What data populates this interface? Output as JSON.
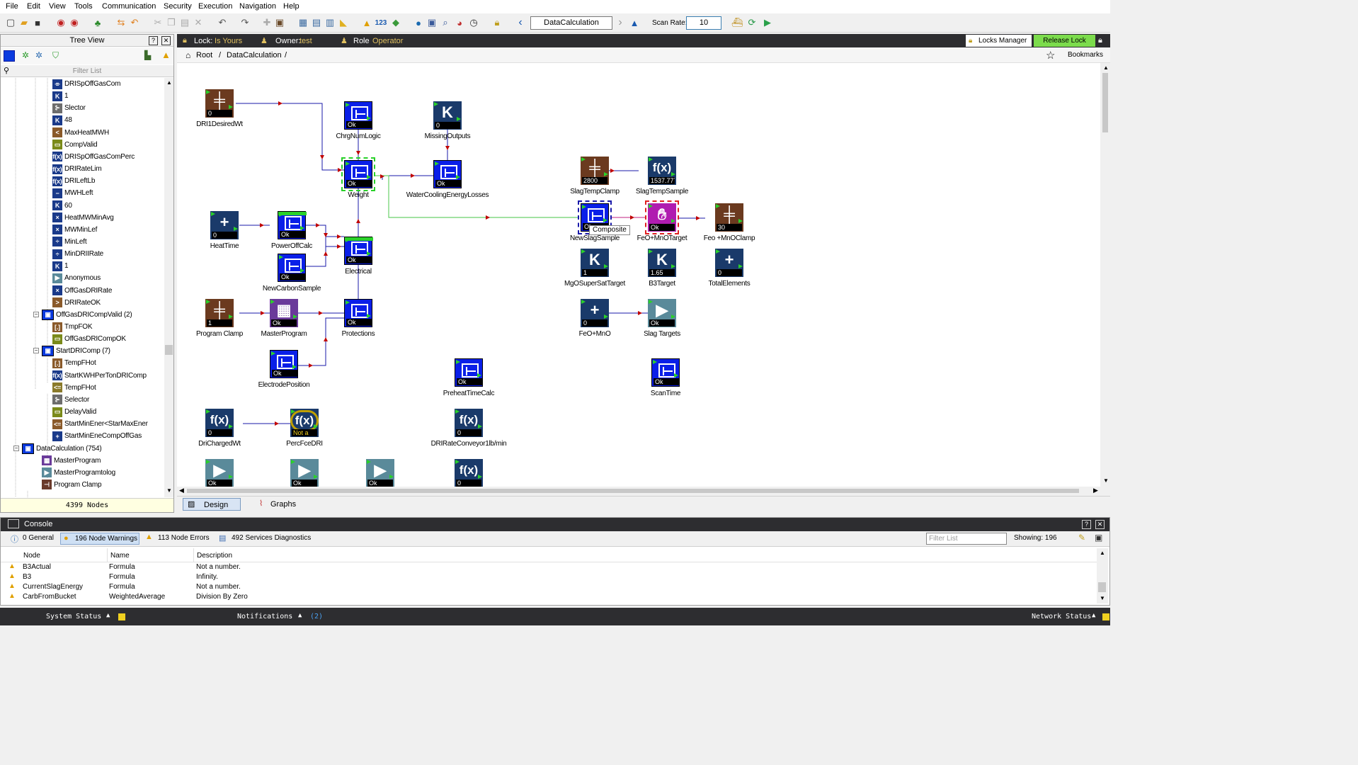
{
  "menu": [
    "File",
    "Edit",
    "View",
    "Tools",
    "Communication",
    "Security",
    "Execution",
    "Navigation",
    "Help"
  ],
  "toolbar": {
    "node_name": "DataCalculation",
    "scan_rate_label": "Scan Rate:",
    "scan_rate_value": "10",
    "badge_123": "123"
  },
  "tree": {
    "title": "Tree View",
    "filter_placeholder": "Filter List",
    "footer": "4399 Nodes",
    "items": [
      {
        "label": "DRISpOffGasCom",
        "icon": "switch-icon",
        "color": "#1a3a8a",
        "indent": 1
      },
      {
        "label": "1",
        "icon": "K",
        "color": "#1a3a8a",
        "indent": 1
      },
      {
        "label": "Slector",
        "icon": "selector-icon",
        "color": "#6d6d6d",
        "indent": 1
      },
      {
        "label": "48",
        "icon": "K",
        "color": "#1a3a8a",
        "indent": 1
      },
      {
        "label": "MaxHeatMWH",
        "icon": "<",
        "color": "#8a5a2a",
        "indent": 1
      },
      {
        "label": "CompValid",
        "icon": "delay-icon",
        "color": "#7a8a1a",
        "indent": 1
      },
      {
        "label": "DRISpOffGasComPerc",
        "icon": "f(x)",
        "color": "#1a3a8a",
        "indent": 1
      },
      {
        "label": "DRIRateLim",
        "icon": "f(x)",
        "color": "#1a3a8a",
        "indent": 1
      },
      {
        "label": "DRILeftLb",
        "icon": "f(x)",
        "color": "#1a3a8a",
        "indent": 1
      },
      {
        "label": "MWHLeft",
        "icon": "−",
        "color": "#1a3a8a",
        "indent": 1
      },
      {
        "label": "60",
        "icon": "K",
        "color": "#1a3a8a",
        "indent": 1
      },
      {
        "label": "HeatMWMinAvg",
        "icon": "×",
        "color": "#1a3a8a",
        "indent": 1
      },
      {
        "label": "MWMinLef",
        "icon": "×",
        "color": "#1a3a8a",
        "indent": 1
      },
      {
        "label": "MinLeft",
        "icon": "÷",
        "color": "#1a3a8a",
        "indent": 1
      },
      {
        "label": "MinDRIIRate",
        "icon": "÷",
        "color": "#1a3a8a",
        "indent": 1
      },
      {
        "label": "1",
        "icon": "K",
        "color": "#1a3a8a",
        "indent": 1
      },
      {
        "label": "Anonymous",
        "icon": "▶",
        "color": "#5a8a9a",
        "indent": 1
      },
      {
        "label": "OffGasDRIRate",
        "icon": "×",
        "color": "#1a3a8a",
        "indent": 1
      },
      {
        "label": "DRIRateOK",
        "icon": ">",
        "color": "#8a5a2a",
        "indent": 1
      },
      {
        "label": "OffGasDRICompValid  (2)",
        "icon": "composite-icon",
        "color": "#0a3adf",
        "indent": 0,
        "expand": true
      },
      {
        "label": "TmpFOK",
        "icon": "[.]",
        "color": "#8a5a2a",
        "indent": 1
      },
      {
        "label": "OffGasDRICompOK",
        "icon": "delay-icon",
        "color": "#7a8a1a",
        "indent": 1
      },
      {
        "label": "StartDRIComp  (7)",
        "icon": "composite-icon",
        "color": "#0a3adf",
        "indent": 0,
        "expand": true
      },
      {
        "label": "TempFHot",
        "icon": "[.]",
        "color": "#8a5a2a",
        "indent": 1
      },
      {
        "label": "StartKWHPerTonDRIComp",
        "icon": "f(x)",
        "color": "#1a3a8a",
        "indent": 1
      },
      {
        "label": "TempFHot",
        "icon": "<=",
        "color": "#8a7a2a",
        "indent": 1
      },
      {
        "label": "Selector",
        "icon": "selector-icon",
        "color": "#6d6d6d",
        "indent": 1
      },
      {
        "label": "DelayValid",
        "icon": "delay-icon",
        "color": "#7a8a1a",
        "indent": 1
      },
      {
        "label": "StartMinEner<StarMaxEner",
        "icon": "<=",
        "color": "#8a5a2a",
        "indent": 1
      },
      {
        "label": "StartMinEneCompOffGas",
        "icon": "+",
        "color": "#1a3a8a",
        "indent": 1
      },
      {
        "label": "DataCalculation  (754)",
        "icon": "composite-icon",
        "color": "#0a3adf",
        "indent": -1,
        "expand": true
      },
      {
        "label": "MasterProgram",
        "icon": "grid-icon",
        "color": "#6a3a9a",
        "indent": 0
      },
      {
        "label": "MasterProgramtolog",
        "icon": "▶",
        "color": "#5a8a9a",
        "indent": 0
      },
      {
        "label": "Program Clamp",
        "icon": "clamp-icon",
        "color": "#6a3a2a",
        "indent": 0
      }
    ]
  },
  "lockbar": {
    "lock_label": "Lock:",
    "lock_value": "Is Yours",
    "owner_label": "Owner:",
    "owner_value": "test",
    "role_label": "Role",
    "role_value": "Operator",
    "locks_manager": "Locks Manager",
    "release_lock": "Release Lock"
  },
  "breadcrumb": {
    "root": "Root",
    "current": "DataCalculation",
    "separator": "/",
    "bookmarks": "Bookmarks"
  },
  "tooltip": "Composite",
  "nodes": [
    {
      "id": "DRI1DesiredWt",
      "label": "DRI1DesiredWt",
      "type": "clamp",
      "value": "0"
    },
    {
      "id": "ChrgNumLogic",
      "label": "ChrgNumLogic",
      "type": "composite",
      "value": "Ok"
    },
    {
      "id": "MissingOutputs",
      "label": "MissingOutputs",
      "type": "const",
      "value": "0"
    },
    {
      "id": "Weight",
      "label": "Weight",
      "type": "composite",
      "value": "Ok",
      "selected": "green"
    },
    {
      "id": "WaterCoolingEnergyLosses",
      "label": "WaterCoolingEnergyLosses",
      "type": "composite",
      "value": "Ok"
    },
    {
      "id": "SlagTempClamp",
      "label": "SlagTempClamp",
      "type": "clamp",
      "value": "2800"
    },
    {
      "id": "SlagTempSample",
      "label": "SlagTempSample",
      "type": "formula",
      "value": "1537.777"
    },
    {
      "id": "HeatTime",
      "label": "HeatTime",
      "type": "plus",
      "value": "0"
    },
    {
      "id": "PowerOffCalc",
      "label": "PowerOffCalc",
      "type": "composite",
      "value": "Ok"
    },
    {
      "id": "Electrical",
      "label": "Electrical",
      "type": "composite",
      "value": "Ok"
    },
    {
      "id": "NewCarbonSample",
      "label": "NewCarbonSample",
      "type": "composite",
      "value": "Ok"
    },
    {
      "id": "NewSlagSample",
      "label": "NewSlagSample",
      "type": "composite",
      "value": "Ok",
      "selected": "blue"
    },
    {
      "id": "FeOMnOTarget",
      "label": "FeO+MnOTarget",
      "type": "hand",
      "value": "Ok",
      "selected": "red"
    },
    {
      "id": "FeoMnOClamp",
      "label": "Feo +MnOClamp",
      "type": "clamp",
      "value": "30"
    },
    {
      "id": "MgOSuperSatTarget",
      "label": "MgOSuperSatTarget",
      "type": "const",
      "value": "1"
    },
    {
      "id": "B3Target",
      "label": "B3Target",
      "type": "const",
      "value": "1.65"
    },
    {
      "id": "TotalElements",
      "label": "TotalElements",
      "type": "plus",
      "value": "0"
    },
    {
      "id": "ProgramClamp",
      "label": "Program Clamp",
      "type": "clamp",
      "value": "1"
    },
    {
      "id": "MasterProgram",
      "label": "MasterProgram",
      "type": "grid",
      "value": "Ok"
    },
    {
      "id": "Protections",
      "label": "Protections",
      "type": "composite",
      "value": "Ok"
    },
    {
      "id": "FeOMnO",
      "label": "FeO+MnO",
      "type": "plus",
      "value": "0"
    },
    {
      "id": "SlagTargets",
      "label": "Slag Targets",
      "type": "play",
      "value": "Ok"
    },
    {
      "id": "ElectrodePosition",
      "label": "ElectrodePosition",
      "type": "composite",
      "value": "Ok"
    },
    {
      "id": "PreheatTimeCalc",
      "label": "PreheatTimeCalc",
      "type": "composite",
      "value": "Ok"
    },
    {
      "id": "ScanTime",
      "label": "ScanTime",
      "type": "composite",
      "value": "Ok"
    },
    {
      "id": "DriChargedWt",
      "label": "DriChargedWt",
      "type": "formula",
      "value": "0"
    },
    {
      "id": "PercFceDRI",
      "label": "PercFceDRI",
      "type": "formula-warn",
      "value": "Not a"
    },
    {
      "id": "DRIRateConveyor",
      "label": "DRIRateConveyor1lb/min",
      "type": "formula",
      "value": "0"
    },
    {
      "id": "Play1",
      "label": "",
      "type": "play",
      "value": "Ok"
    },
    {
      "id": "Play2",
      "label": "",
      "type": "play",
      "value": "Ok"
    },
    {
      "id": "Play3",
      "label": "",
      "type": "play",
      "value": "Ok"
    },
    {
      "id": "Formula4",
      "label": "",
      "type": "formula",
      "value": "0"
    }
  ],
  "tabs": {
    "design": "Design",
    "graphs": "Graphs"
  },
  "console": {
    "title": "Console",
    "tabs": [
      {
        "label": "0 General"
      },
      {
        "label": "196 Node Warnings"
      },
      {
        "label": "113 Node Errors"
      },
      {
        "label": "492 Services Diagnostics"
      }
    ],
    "filter_placeholder": "Filter List",
    "showing": "Showing: 196",
    "columns": [
      "Node",
      "Name",
      "Description"
    ],
    "rows": [
      {
        "node": "B3Actual",
        "name": "Formula",
        "desc": "Not a number."
      },
      {
        "node": "B3",
        "name": "Formula",
        "desc": "Infinity."
      },
      {
        "node": "CurrentSlagEnergy",
        "name": "Formula",
        "desc": "Not a number."
      },
      {
        "node": "CarbFromBucket",
        "name": "WeightedAverage",
        "desc": "Division By Zero"
      }
    ]
  },
  "status": {
    "system": "System Status",
    "notifications": "Notifications",
    "notif_count": "(2)",
    "network": "Network Status"
  },
  "colors": {
    "composite": "#0a1fe8",
    "clamp": "#6b3a1f",
    "const": "#1a3a6a",
    "formula": "#1a3a6a",
    "plus": "#1a3a6a",
    "grid": "#6a3a9a",
    "hand": "#b01cb0",
    "play": "#5a8a9a",
    "accent_green": "#7cdc4c"
  }
}
